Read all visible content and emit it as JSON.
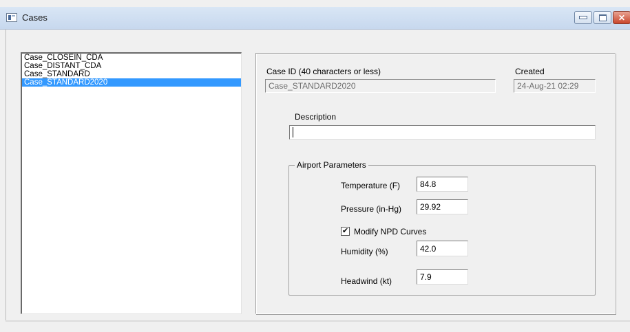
{
  "window": {
    "title": "Cases",
    "controls": {
      "minimize": "",
      "maximize": "",
      "close": "✕"
    }
  },
  "case_list": {
    "items": [
      {
        "label": "Case_CLOSEIN_CDA"
      },
      {
        "label": "Case_DISTANT_CDA"
      },
      {
        "label": "Case_STANDARD"
      },
      {
        "label": "Case_STANDARD2020",
        "selected": true
      }
    ]
  },
  "details": {
    "case_id_label": "Case ID (40 characters or less)",
    "case_id_value": "Case_STANDARD2020",
    "created_label": "Created",
    "created_value": "24-Aug-21 02:29",
    "description_label": "Description",
    "description_value": ""
  },
  "airport_parameters": {
    "legend": "Airport Parameters",
    "temperature_label": "Temperature (F)",
    "temperature_value": "84.8",
    "pressure_label": "Pressure (in-Hg)",
    "pressure_value": "29.92",
    "modify_npd_label": "Modify NPD Curves",
    "modify_npd_checked": true,
    "modify_npd_mark": "✔",
    "humidity_label": "Humidity (%)",
    "humidity_value": "42.0",
    "headwind_label": "Headwind (kt)",
    "headwind_value": "7.9"
  }
}
